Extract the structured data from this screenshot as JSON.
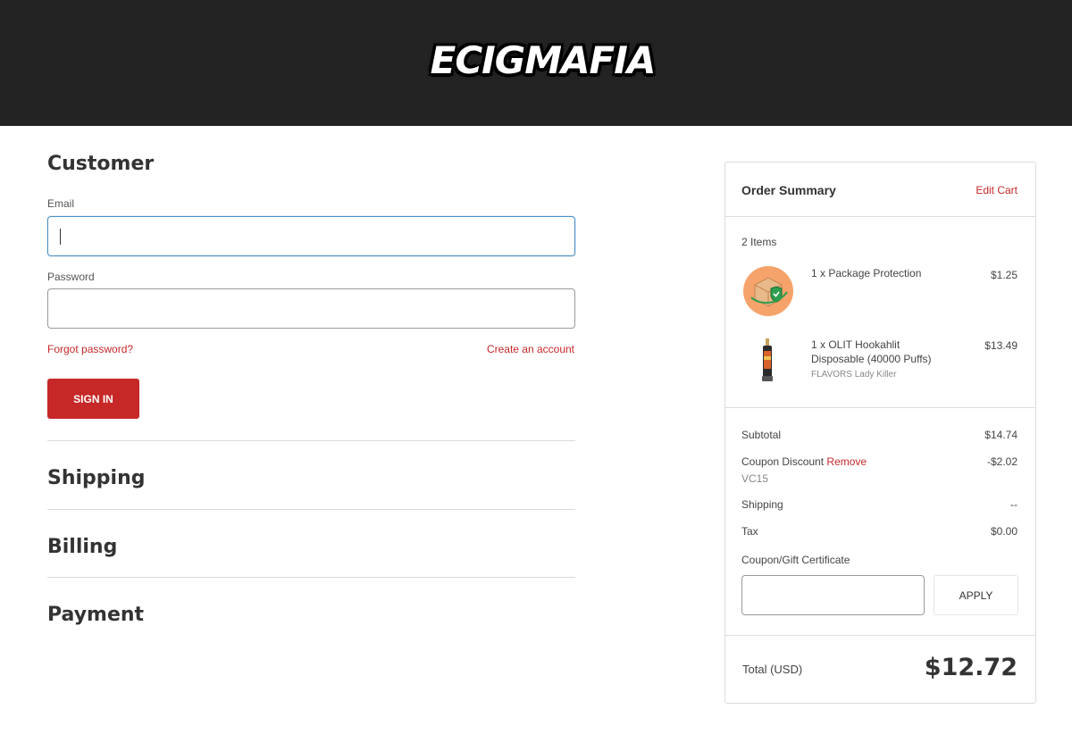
{
  "header": {
    "logo_text": "ECIGMAFIA"
  },
  "customer": {
    "title": "Customer",
    "email_label": "Email",
    "email_value": "",
    "password_label": "Password",
    "password_value": "",
    "forgot_password": "Forgot password?",
    "create_account": "Create an account",
    "sign_in": "SIGN IN"
  },
  "sections": {
    "shipping": "Shipping",
    "billing": "Billing",
    "payment": "Payment"
  },
  "order_summary": {
    "title": "Order Summary",
    "edit_cart": "Edit Cart",
    "items_count": "2 Items",
    "items": [
      {
        "name": "1 x Package Protection",
        "price": "$1.25",
        "option": ""
      },
      {
        "name": "1 x OLIT Hookahlit Disposable (40000 Puffs)",
        "price": "$13.49",
        "option": "FLAVORS Lady Killer"
      }
    ],
    "subtotal_label": "Subtotal",
    "subtotal_value": "$14.74",
    "coupon_label": "Coupon Discount",
    "coupon_remove": "Remove",
    "coupon_value": "-$2.02",
    "coupon_code": "VC15",
    "shipping_label": "Shipping",
    "shipping_value": "--",
    "tax_label": "Tax",
    "tax_value": "$0.00",
    "gift_label": "Coupon/Gift Certificate",
    "gift_value": "",
    "apply": "APPLY",
    "total_label": "Total (USD)",
    "total_value": "$12.72"
  },
  "colors": {
    "header_bg": "#232323",
    "accent": "#c62828",
    "focus": "#4a90c8"
  }
}
